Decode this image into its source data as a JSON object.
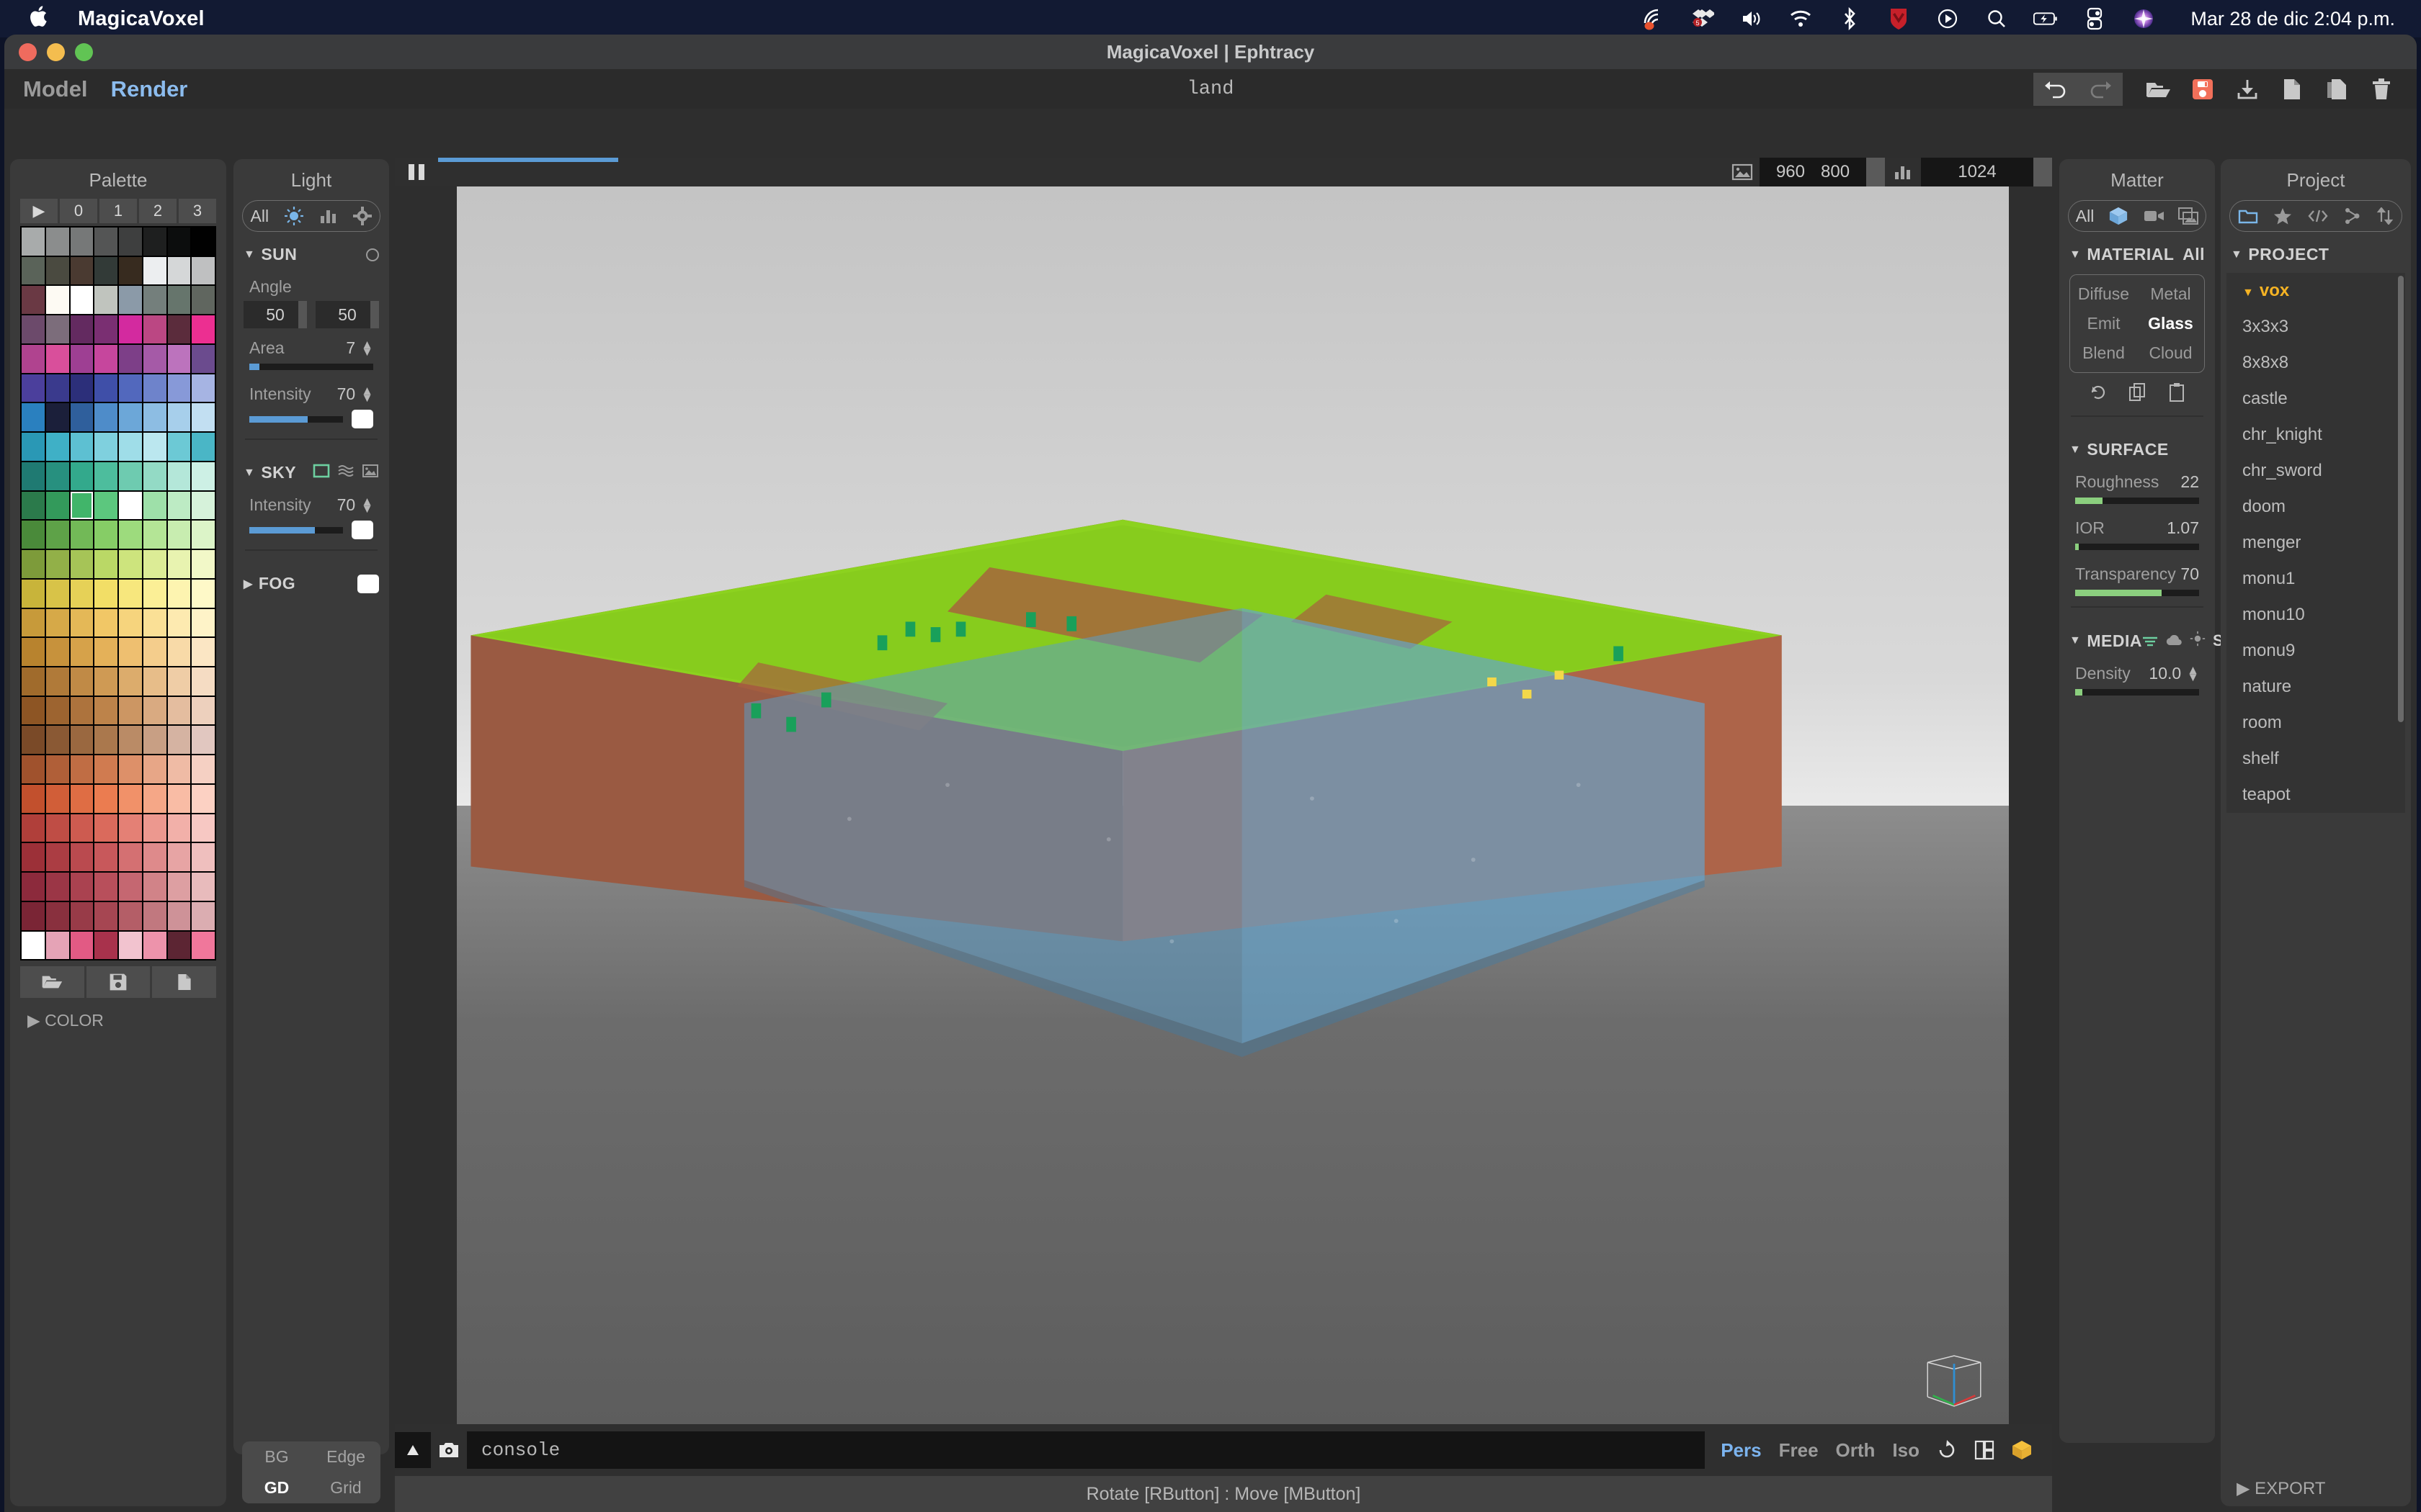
{
  "os_bar": {
    "apple_glyph": "",
    "app_name": "MagicaVoxel",
    "clock": "Mar 28 de dic  2:04 p.m.",
    "tray_icons": [
      "nearby-share-icon",
      "dropbox-icon",
      "volume-icon",
      "wifi-icon",
      "bluetooth-icon",
      "vivaldi-icon",
      "player-icon",
      "spotlight-search-icon",
      "battery-charging-icon",
      "control-center-icon",
      "siri-icon"
    ],
    "dropbox_badge": "5"
  },
  "window": {
    "title": "MagicaVoxel | Ephtracy"
  },
  "tabs": {
    "model": "Model",
    "render": "Render",
    "doc_name": "land"
  },
  "toolbar": {
    "undo": "undo-icon",
    "redo": "redo-icon",
    "open": "open-folder-icon",
    "save": "save-icon",
    "download": "download-icon",
    "new": "new-file-icon",
    "copy": "copy-icon",
    "delete": "trash-icon",
    "save_color": "#f2705a"
  },
  "palette": {
    "title": "Palette",
    "tabs": [
      "▶",
      "0",
      "1",
      "2",
      "3"
    ],
    "selected_index": 74,
    "buttons": [
      "open-palette-icon",
      "save-palette-icon",
      "new-palette-icon"
    ],
    "color_section": "COLOR",
    "color_caret": "▶",
    "colors": [
      "#a8abab",
      "#8b8d8d",
      "#767878",
      "#545555",
      "#3e3f3f",
      "#1e1f1f",
      "#0c0d0d",
      "#010101",
      "#5a6359",
      "#4a4a40",
      "#4a3a31",
      "#323a37",
      "#372b1f",
      "#eceef0",
      "#d5d7d8",
      "#bfc0c1",
      "#6a3944",
      "#fdfaf3",
      "#ffffff",
      "#c0c4be",
      "#8b9aa8",
      "#747f7c",
      "#66756c",
      "#60665f",
      "#6c4a6b",
      "#7c6d7b",
      "#632a60",
      "#7a2f72",
      "#d32a9f",
      "#bb4783",
      "#5b2c3c",
      "#ec2f91",
      "#b0438f",
      "#d94f9b",
      "#9e3f93",
      "#c6469d",
      "#7d3f88",
      "#a55aa7",
      "#bc73bd",
      "#6b4b8e",
      "#4b3f9c",
      "#3a3a8d",
      "#2c2f7a",
      "#3f4fa8",
      "#5268bd",
      "#6e83cb",
      "#8799d8",
      "#a6b4e3",
      "#2a80bf",
      "#1b1f3a",
      "#2f5f9c",
      "#4e8cc9",
      "#6ca7d8",
      "#8dbde3",
      "#a7cfeb",
      "#c2dff2",
      "#2a98b5",
      "#3fb0c6",
      "#5dc0d2",
      "#7fd0de",
      "#9fdde8",
      "#bbe7ef",
      "#6cc9d5",
      "#4ab6c6",
      "#1f7a72",
      "#27907f",
      "#33a98c",
      "#4dbd9d",
      "#6ecbb0",
      "#93dac5",
      "#b4e7d9",
      "#cdf0e5",
      "#2b7a4b",
      "#339a5b",
      "#41b56a",
      "#5cc77e",
      "#ffffff",
      "#9ee0a9",
      "#bdebc4",
      "#d6f2da",
      "#4a8a3a",
      "#5ea248",
      "#72b957",
      "#86cd66",
      "#9ddb7d",
      "#b4e596",
      "#c8edb0",
      "#dcf4c8",
      "#7d9b3a",
      "#92b048",
      "#a6c457",
      "#bad866",
      "#cde47d",
      "#dcec96",
      "#e8f3b0",
      "#f2f8c8",
      "#c8b43a",
      "#d8c348",
      "#e6d157",
      "#f2de66",
      "#f7e77d",
      "#fbef96",
      "#fdf4b0",
      "#fef9c8",
      "#c79a3a",
      "#d6a948",
      "#e4b857",
      "#f1c766",
      "#f6d47d",
      "#fae096",
      "#fdeab0",
      "#fef3c8",
      "#b8832e",
      "#c7923c",
      "#d6a24a",
      "#e4b159",
      "#eebf70",
      "#f4cd8c",
      "#f8daa8",
      "#fbe6c4",
      "#a06b2c",
      "#b07a39",
      "#c08a46",
      "#cf9a54",
      "#dcac6c",
      "#e7bd89",
      "#efcda6",
      "#f5dcc3",
      "#8d5524",
      "#9d6430",
      "#ad733d",
      "#bd834a",
      "#cc9663",
      "#d9aa81",
      "#e4bd9f",
      "#edd0bd",
      "#7a4a28",
      "#8a5934",
      "#9a6840",
      "#aa784d",
      "#ba8b66",
      "#c89f84",
      "#d5b3a2",
      "#e1c7c0",
      "#a0522d",
      "#b05f38",
      "#c06d44",
      "#d07b50",
      "#dd9069",
      "#e7a687",
      "#efbba5",
      "#f5d0c3",
      "#c2502d",
      "#d15e38",
      "#df6d44",
      "#eb7c50",
      "#f19169",
      "#f5a787",
      "#f9bca5",
      "#fcd1c3",
      "#b03f3a",
      "#bf4d45",
      "#cd5b50",
      "#da6a5c",
      "#e48075",
      "#ec988f",
      "#f2b0a9",
      "#f7c8c3",
      "#9c3038",
      "#ab3d43",
      "#ba4a4f",
      "#c8585b",
      "#d47072",
      "#de8a8b",
      "#e7a4a4",
      "#efbfbe",
      "#8c2a3c",
      "#9b3646",
      "#aa4250",
      "#b84f5b",
      "#c56771",
      "#d18388",
      "#dd9fa2",
      "#e8bbbc",
      "#7a2535",
      "#89303e",
      "#983b48",
      "#a64652",
      "#b45e67",
      "#c1787f",
      "#ce9298",
      "#dbadb1",
      "#ffffff",
      "#e5a3b6",
      "#e25a84",
      "#a8324c",
      "#f2c3cf",
      "#ed93ab",
      "#5c2533",
      "#f0779b"
    ]
  },
  "light": {
    "title": "Light",
    "segments": [
      "All",
      "sun-icon",
      "histogram-icon",
      "gear-icon"
    ],
    "sun": {
      "label": "SUN",
      "caret": "▼",
      "toggle": "circle-toggle-icon",
      "angle_label": "Angle",
      "angle_1": "50",
      "angle_2": "50",
      "area_label": "Area",
      "area_value": "7",
      "area_pct": 8,
      "intensity_label": "Intensity",
      "intensity_value": "70",
      "intensity_pct": 62,
      "color_chip": "#ffffff"
    },
    "sky": {
      "label": "SKY",
      "caret": "▼",
      "icons": [
        "flat-color-icon",
        "gradient-icon",
        "hdr-image-icon"
      ],
      "intensity_label": "Intensity",
      "intensity_value": "70",
      "intensity_pct": 70,
      "color_chip": "#ffffff",
      "active_color": "#6dcfa0"
    },
    "fog": {
      "label": "FOG",
      "caret": "▶",
      "color_chip": "#ffffff"
    }
  },
  "view_toggles": {
    "bg": "BG",
    "edge": "Edge",
    "gd": "GD",
    "grid": "Grid",
    "active": "GD"
  },
  "render_bar": {
    "pause": "pause-icon",
    "progress_pct": 14,
    "image_icon": "image-icon",
    "width": "960",
    "height": "800",
    "samples_icon": "samples-icon",
    "samples": "1024"
  },
  "viewport": {
    "console_label": "console",
    "screenshot_icon": "camera-icon",
    "collapse_icon": "triangle-up-icon",
    "view_modes": [
      "Pers",
      "Free",
      "Orth",
      "Iso"
    ],
    "active_view_mode": "Pers",
    "extra_icons": [
      "rotate-view-icon",
      "layout-icon",
      "cube-icon"
    ],
    "gizmo": "axis-gizmo",
    "status": "Rotate [RButton] : Move [MButton]"
  },
  "matter": {
    "title": "Matter",
    "segments": [
      "All",
      "cube-icon",
      "camera-icon",
      "image-icon"
    ],
    "material": {
      "label": "MATERIAL",
      "caret": "▼",
      "all": "All",
      "types": [
        "Diffuse",
        "Metal",
        "Emit",
        "Glass",
        "Blend",
        "Cloud"
      ],
      "active_type": "Glass",
      "actions": [
        "reset-icon",
        "copy-icon",
        "paste-icon"
      ]
    },
    "surface": {
      "label": "SURFACE",
      "caret": "▼",
      "roughness_label": "Roughness",
      "roughness_value": "22",
      "roughness_pct": 22,
      "ior_label": "IOR",
      "ior_value": "1.07",
      "ior_pct": 3,
      "transparency_label": "Transparency",
      "transparency_value": "70",
      "transparency_pct": 70
    },
    "media": {
      "label": "MEDIA",
      "caret": "▼",
      "icons": [
        "absorb-icon",
        "cloud-icon",
        "scatter-icon"
      ],
      "suffix": "S",
      "density_label": "Density",
      "density_value": "10.0"
    }
  },
  "project": {
    "title": "Project",
    "segments": [
      "folder-icon",
      "star-icon",
      "code-icon",
      "node-icon",
      "sort-icon"
    ],
    "section_label": "PROJECT",
    "section_caret": "▼",
    "root": "vox",
    "root_caret": "▼",
    "items": [
      "3x3x3",
      "8x8x8",
      "castle",
      "chr_knight",
      "chr_sword",
      "doom",
      "menger",
      "monu1",
      "monu10",
      "monu9",
      "nature",
      "room",
      "shelf",
      "teapot"
    ],
    "export_label": "EXPORT",
    "export_caret": "▶"
  }
}
